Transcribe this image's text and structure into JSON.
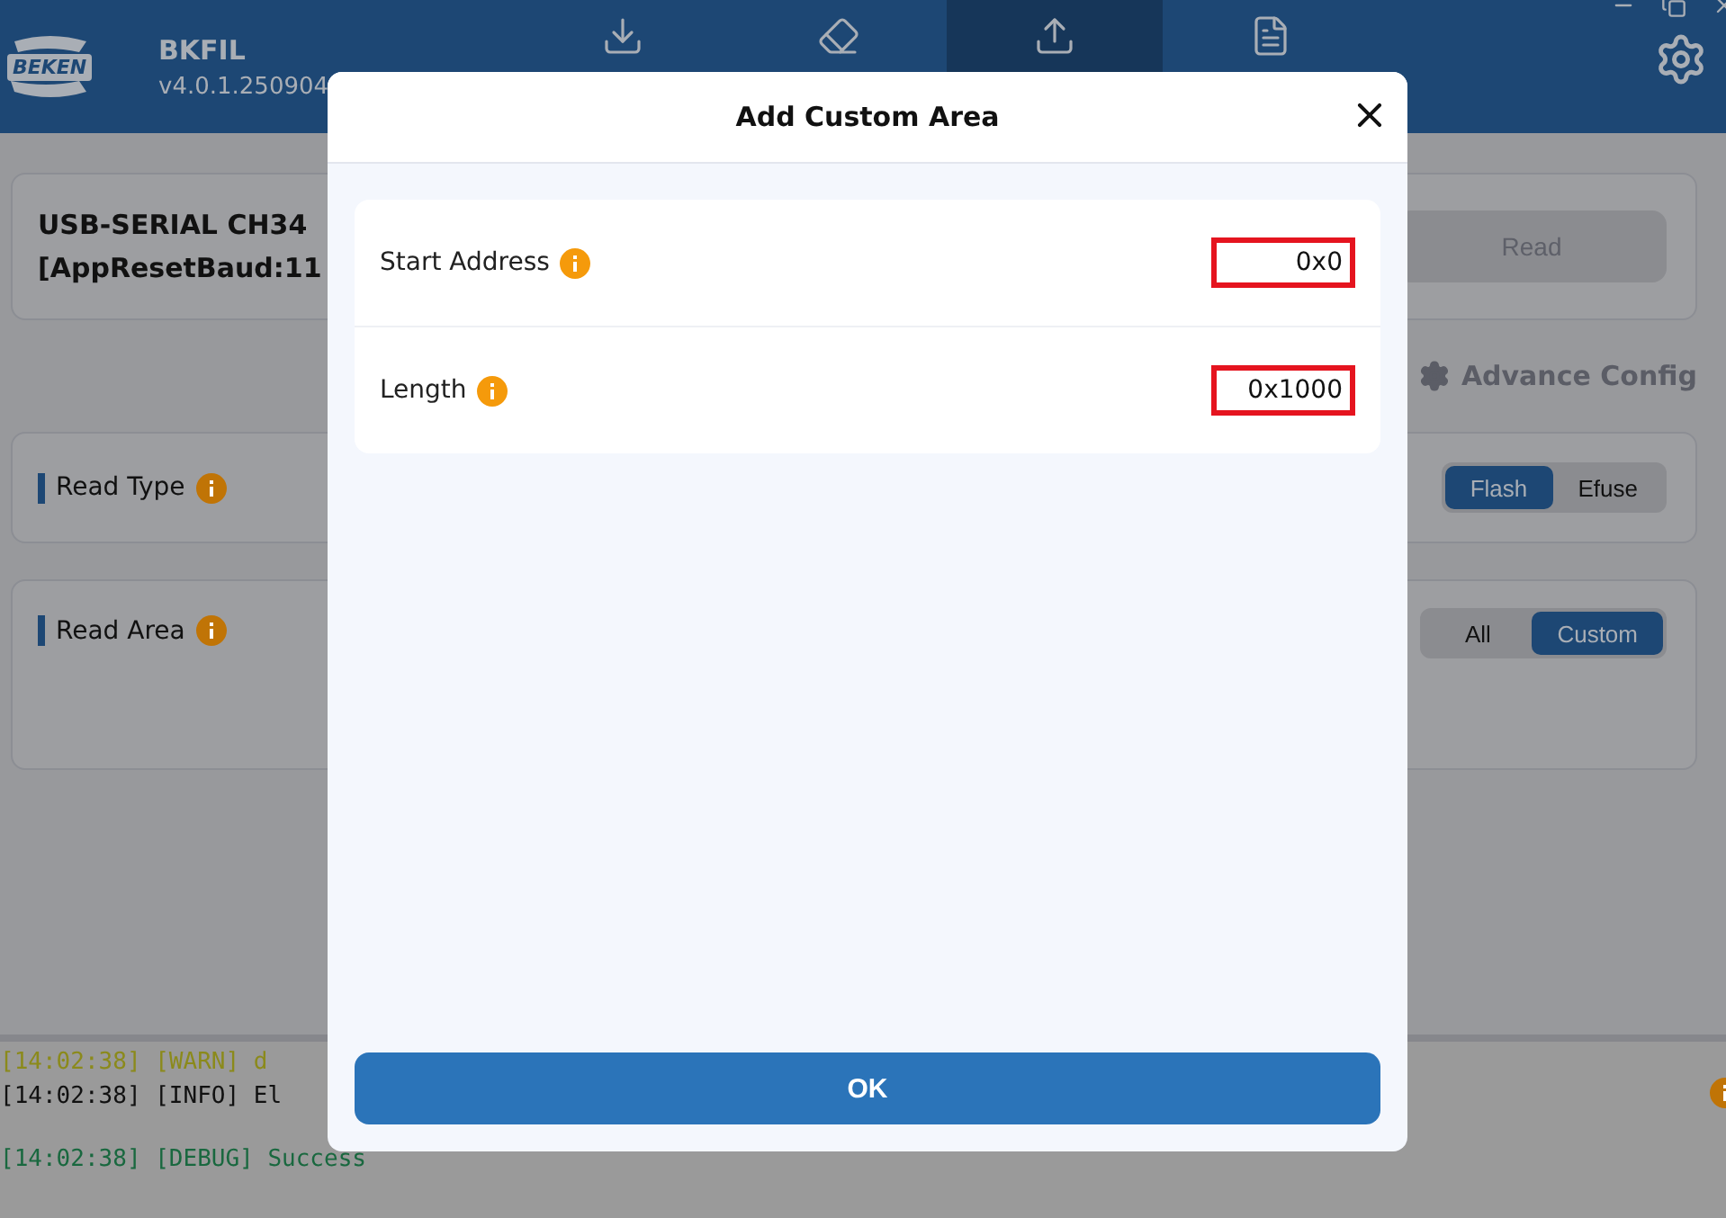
{
  "app": {
    "logo": "BEKEN",
    "name": "BKFIL",
    "version": "v4.0.1.250904"
  },
  "nav_tabs": [
    {
      "kind": "download",
      "selected": false
    },
    {
      "kind": "erase",
      "selected": false
    },
    {
      "kind": "upload",
      "selected": true
    },
    {
      "kind": "document",
      "selected": false
    }
  ],
  "device": {
    "line_1": "USB-SERIAL CH34",
    "line_2": "[AppResetBaud:11"
  },
  "read_button": {
    "label": "Read",
    "disabled": true
  },
  "advance_config": "Advance Config",
  "read_type": {
    "label": "Read Type",
    "options": [
      {
        "label": "Flash",
        "selected": true
      },
      {
        "label": "Efuse",
        "selected": false
      }
    ]
  },
  "read_area": {
    "label": "Read Area",
    "options": [
      {
        "label": "All",
        "selected": false
      },
      {
        "label": "Custom",
        "selected": true
      }
    ]
  },
  "log": [
    {
      "kind": "warn",
      "text": "[14:02:38] [WARN] d"
    },
    {
      "kind": "info",
      "text": "[14:02:38] [INFO] El"
    },
    {
      "kind": "debug",
      "text": "[14:02:38] [DEBUG] Success"
    }
  ],
  "dialog": {
    "title": "Add Custom Area",
    "fields": [
      {
        "label": "Start Address",
        "value": "0x0"
      },
      {
        "label": "Length",
        "value": "0x1000"
      }
    ],
    "ok": "OK"
  }
}
